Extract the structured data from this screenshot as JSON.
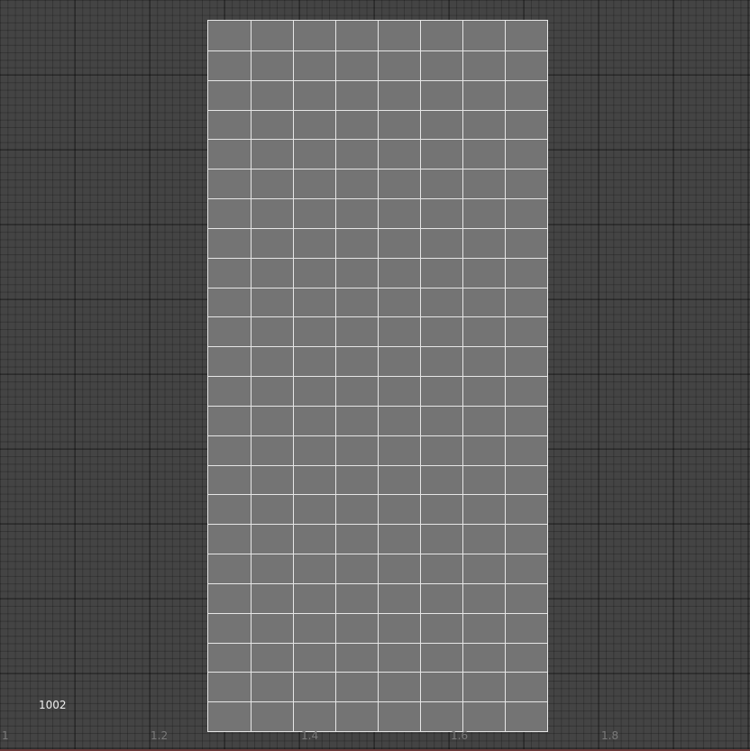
{
  "viewport": {
    "tile_label": "1002",
    "u_ticks": [
      "1",
      "1.2",
      "1.4",
      "1.6",
      "1.8"
    ],
    "colors": {
      "background": "#444444",
      "shell_fill": "#747474",
      "wire": "#e6e6e6",
      "tick_text": "#7a7a7a"
    }
  },
  "uv_shell": {
    "rows": 24,
    "columns": 8
  }
}
